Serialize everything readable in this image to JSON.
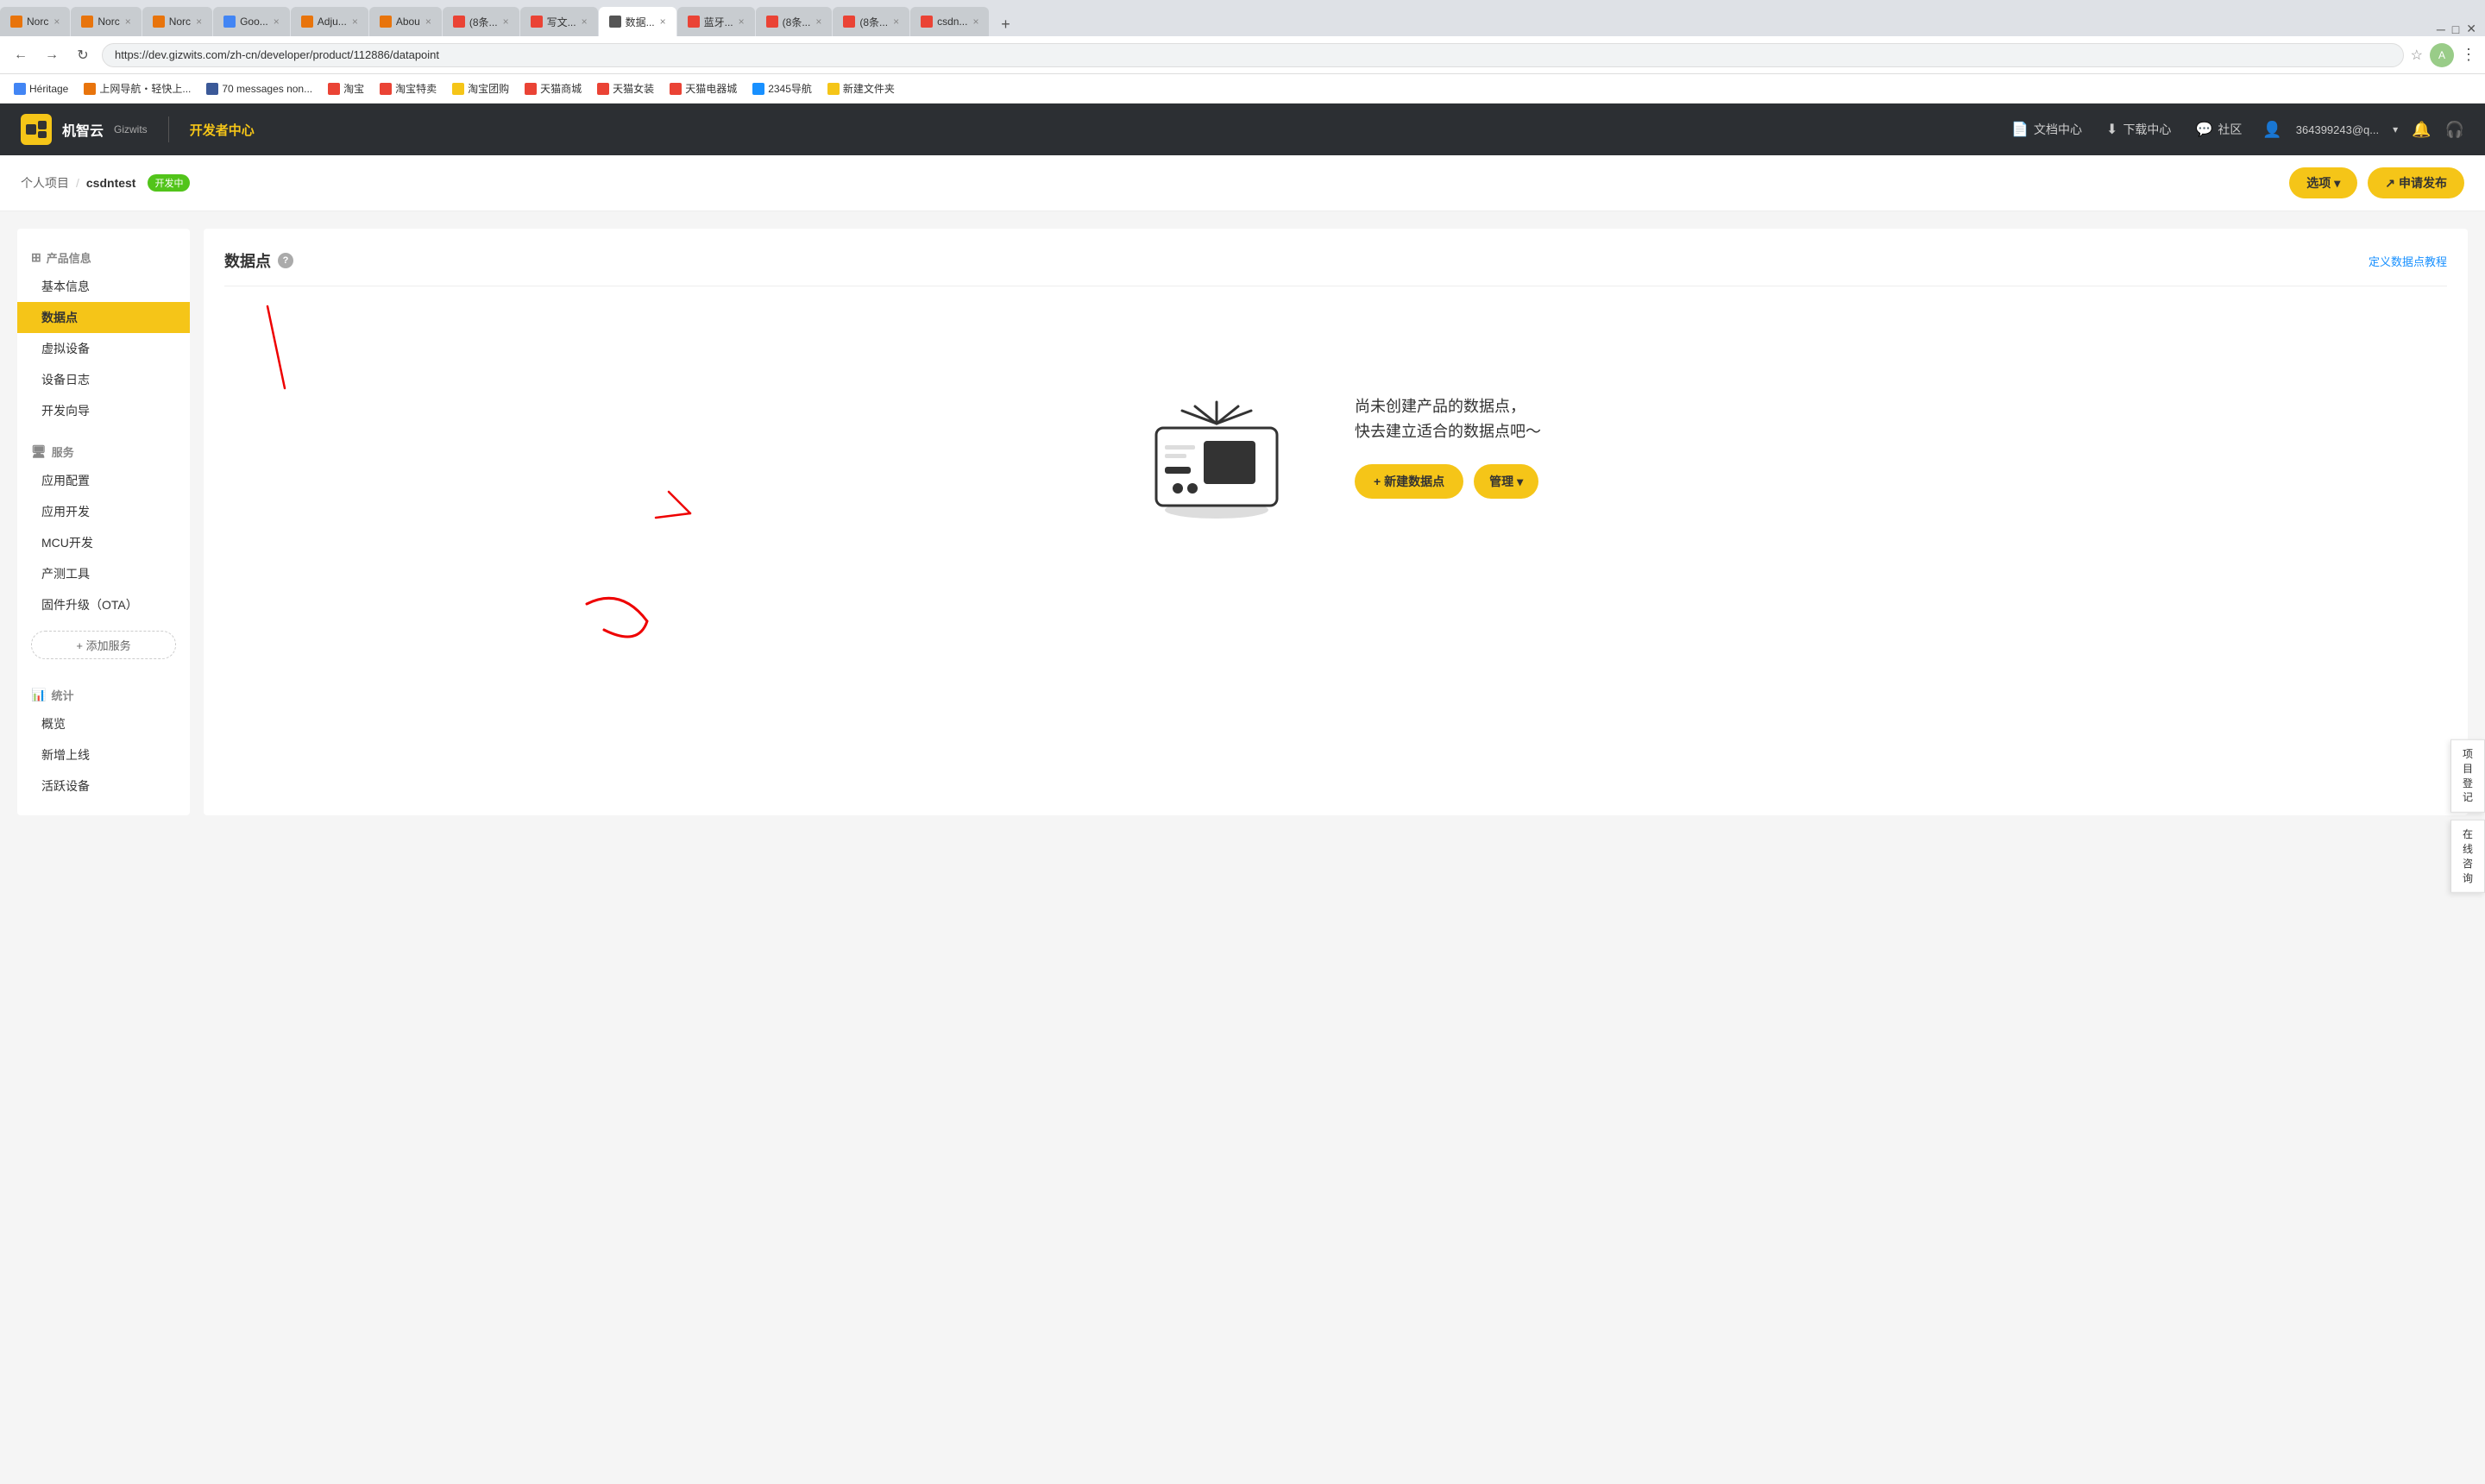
{
  "browser": {
    "tabs": [
      {
        "label": "Norc",
        "active": false,
        "favicon_color": "#e8740c"
      },
      {
        "label": "Norc",
        "active": false,
        "favicon_color": "#e8740c"
      },
      {
        "label": "Norc",
        "active": false,
        "favicon_color": "#e8740c"
      },
      {
        "label": "Goo...",
        "active": false,
        "favicon_color": "#4285f4"
      },
      {
        "label": "Adju...",
        "active": false,
        "favicon_color": "#e8740c"
      },
      {
        "label": "Abou",
        "active": false,
        "favicon_color": "#e8740c"
      },
      {
        "label": "(8条...",
        "active": false,
        "favicon_color": "#ea4335"
      },
      {
        "label": "写文...",
        "active": false,
        "favicon_color": "#ea4335"
      },
      {
        "label": "数据...",
        "active": true,
        "favicon_color": "#333"
      },
      {
        "label": "蓝牙...",
        "active": false,
        "favicon_color": "#ea4335"
      },
      {
        "label": "(8条...",
        "active": false,
        "favicon_color": "#ea4335"
      },
      {
        "label": "(8条...",
        "active": false,
        "favicon_color": "#ea4335"
      },
      {
        "label": "csdn...",
        "active": false,
        "favicon_color": "#ea4335"
      }
    ],
    "url": "https://dev.gizwits.com/zh-cn/developer/product/112886/datapoint",
    "bookmarks": [
      {
        "label": "Héritage",
        "favicon_color": "#4285f4"
      },
      {
        "label": "上网导航・轻快上...",
        "favicon_color": "#e8740c"
      },
      {
        "label": "70 messages non...",
        "favicon_color": "#3b5998"
      },
      {
        "label": "淘宝",
        "favicon_color": "#ea4335"
      },
      {
        "label": "淘宝特卖",
        "favicon_color": "#ea4335"
      },
      {
        "label": "淘宝团购",
        "favicon_color": "#f5c518"
      },
      {
        "label": "天猫商城",
        "favicon_color": "#ea4335"
      },
      {
        "label": "天猫女装",
        "favicon_color": "#ea4335"
      },
      {
        "label": "天猫电器城",
        "favicon_color": "#ea4335"
      },
      {
        "label": "2345导航",
        "favicon_color": "#1890ff"
      },
      {
        "label": "新建文件夹",
        "favicon_color": "#f5c518"
      }
    ]
  },
  "nav": {
    "logo_text": "机智云",
    "logo_sub": "Gizwits",
    "dev_center": "开发者中心",
    "links": [
      {
        "icon": "📄",
        "label": "文档中心"
      },
      {
        "icon": "⬇",
        "label": "下载中心"
      },
      {
        "icon": "💬",
        "label": "社区"
      }
    ],
    "user": "364399243@q...",
    "bell": "🔔",
    "headphone": "🎧"
  },
  "header": {
    "breadcrumb_home": "个人项目",
    "breadcrumb_sep": "/",
    "project_name": "csdntest",
    "status": "开发中",
    "btn_options": "选项",
    "btn_publish": "申请发布"
  },
  "sidebar": {
    "sections": [
      {
        "title": "产品信息",
        "icon": "⊞",
        "items": [
          {
            "label": "基本信息",
            "active": false
          },
          {
            "label": "数据点",
            "active": true
          },
          {
            "label": "虚拟设备",
            "active": false
          },
          {
            "label": "设备日志",
            "active": false
          },
          {
            "label": "开发向导",
            "active": false
          }
        ]
      },
      {
        "title": "服务",
        "icon": "🖥",
        "items": [
          {
            "label": "应用配置",
            "active": false
          },
          {
            "label": "应用开发",
            "active": false
          },
          {
            "label": "MCU开发",
            "active": false
          },
          {
            "label": "产测工具",
            "active": false
          },
          {
            "label": "固件升级（OTA）",
            "active": false
          }
        ]
      },
      {
        "title": "统计",
        "icon": "📊",
        "items": [
          {
            "label": "概览",
            "active": false
          },
          {
            "label": "新增上线",
            "active": false
          },
          {
            "label": "活跃设备",
            "active": false
          }
        ]
      }
    ],
    "add_service": "+ 添加服务"
  },
  "main": {
    "title": "数据点",
    "tutorial_link": "定义数据点教程",
    "empty_message_line1": "尚未创建产品的数据点，",
    "empty_message_line2": "快去建立适合的数据点吧～",
    "btn_create": "+ 新建数据点",
    "btn_manage": "管理",
    "btn_manage_arrow": "▾"
  },
  "side_panel": [
    {
      "lines": [
        "项",
        "目",
        "登",
        "记"
      ]
    },
    {
      "lines": [
        "在",
        "线",
        "咨",
        "询"
      ]
    }
  ]
}
